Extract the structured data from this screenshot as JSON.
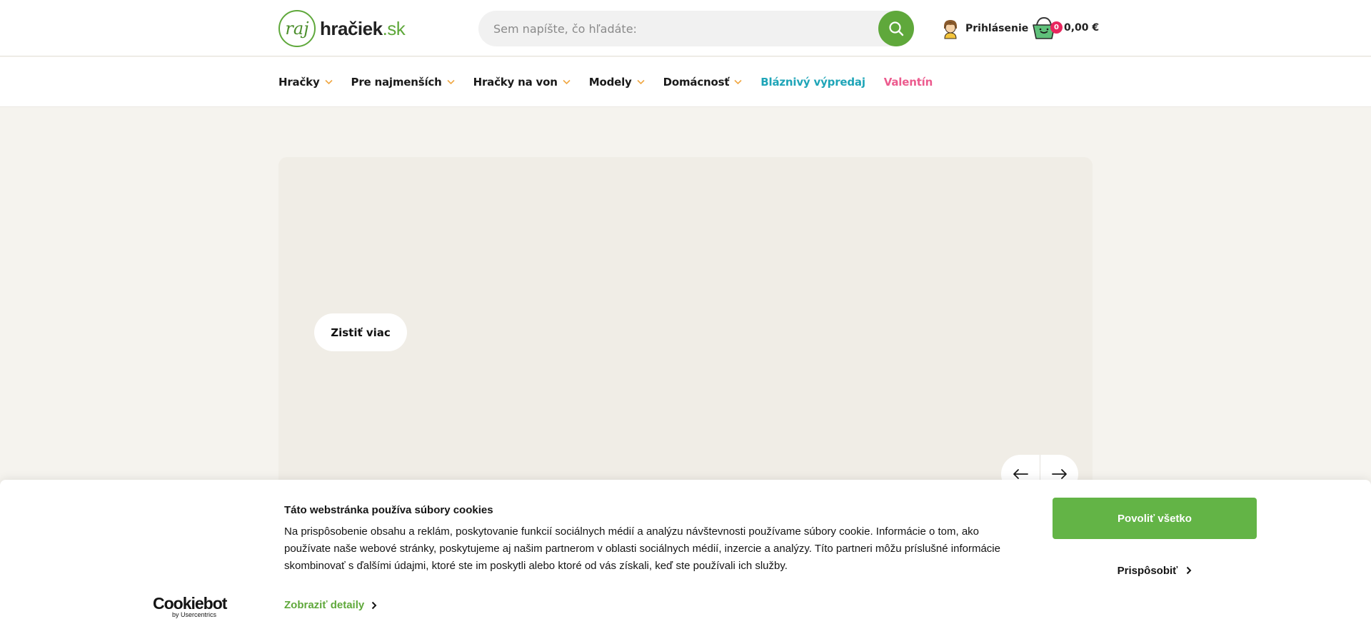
{
  "header": {
    "logo": {
      "circle_text": "raj",
      "name_main": "hračiek",
      "name_tld": ".sk"
    },
    "search": {
      "placeholder": "Sem napíšte, čo hľadáte:"
    },
    "login": {
      "label": "Prihlásenie"
    },
    "cart": {
      "count": "0",
      "total": "0,00 €"
    }
  },
  "nav": {
    "items": [
      {
        "label": "Hračky",
        "dropdown": true
      },
      {
        "label": "Pre najmenších",
        "dropdown": true
      },
      {
        "label": "Hračky na von",
        "dropdown": true
      },
      {
        "label": "Modely",
        "dropdown": true
      },
      {
        "label": "Domácnosť",
        "dropdown": true
      },
      {
        "label": "Bláznivý výpredaj",
        "dropdown": false,
        "color": "#1fa5b8"
      },
      {
        "label": "Valentín",
        "dropdown": false,
        "color": "#ec5b8e"
      }
    ]
  },
  "hero": {
    "cta_label": "Zistiť viac"
  },
  "cookie_banner": {
    "brand": {
      "name": "Cookiebot",
      "sub": "by Usercentrics"
    },
    "title": "Táto webstránka používa súbory cookies",
    "body": "Na prispôsobenie obsahu a reklám, poskytovanie funkcií sociálnych médií a analýzu návštevnosti používame súbory cookie. Informácie o tom, ako používate naše webové stránky, poskytujeme aj našim partnerom v oblasti sociálnych médií, inzercie a analýzy. Títo partneri môžu príslušné informácie skombinovať s ďalšími údajmi, ktoré ste im poskytli alebo ktoré od vás získali, keď ste používali ich služby.",
    "details_label": "Zobraziť detaily",
    "allow_all_label": "Povoliť všetko",
    "customize_label": "Prispôsobiť"
  },
  "colors": {
    "brand_green": "#5fa83b",
    "allow_button": "#63b446",
    "cart_badge": "#e8265e",
    "page_bg": "#f5f3ee"
  }
}
